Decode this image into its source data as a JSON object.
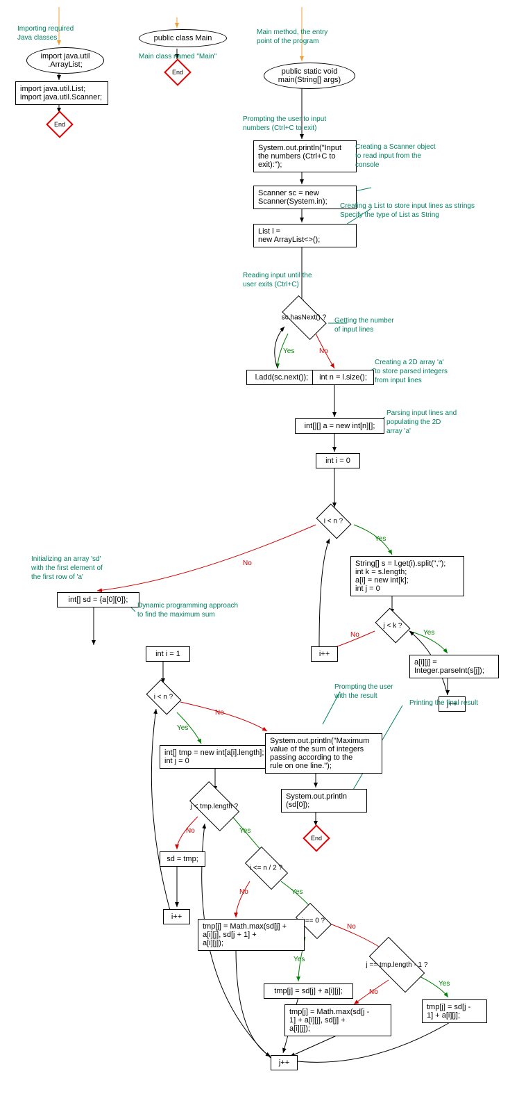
{
  "annotations": {
    "a1": "Importing required\nJava classes",
    "a2": "Main class named \"Main\"",
    "a3": "Main method, the entry\npoint of the program",
    "a4": "Prompting the user to input\nnumbers (Ctrl+C to exit)",
    "a5": "Creating a Scanner object\nto read input from the\nconsole",
    "a6": "Creating a List to store input lines as strings\nSpecify the type of List as String",
    "a7": "Reading input until the\nuser exits (Ctrl+C)",
    "a8": "Getting the number\nof input lines",
    "a9": "Creating a 2D array 'a'\nto store parsed integers\nfrom input lines",
    "a10": "Parsing input lines and\npopulating the 2D\narray 'a'",
    "a11": "Initializing an array 'sd'\nwith the first element of\nthe first row of 'a'",
    "a12": "Dynamic programming approach\nto find the maximum sum",
    "a13": "Prompting the user\nwith the result",
    "a14": "Printing the final result"
  },
  "nodes": {
    "n1": "import java.util\n.ArrayList;",
    "n2": "import java.util.List;\nimport java.util.Scanner;",
    "n3": "public class Main",
    "n4": "public static void\nmain(String[] args)",
    "n5": "System.out.println(\"Input\nthe numbers (Ctrl+C to\nexit):\");",
    "n6": "Scanner sc = new\nScanner(System.in);",
    "n7": "List<String> l =\nnew ArrayList<>();",
    "n8": "sc.hasNext() ?",
    "n9": "l.add(sc.next());",
    "n10": "int n = l.size();",
    "n11": "int[][] a = new int[n][];",
    "n12": "int i = 0",
    "n13": "i < n ?",
    "n14": "String[] s = l.get(i).split(\",\");\nint k = s.length;\na[i] = new int[k];\nint j = 0",
    "n15": "j < k ?",
    "n16": "a[i][j] =\nInteger.parseInt(s[j]);",
    "n17": "j++",
    "n18": "i++",
    "n19": "int[] sd = {a[0][0]};",
    "n20": "int i = 1",
    "n21": "i < n ?",
    "n22": "int[] tmp = new int[a[i].length];\nint j = 0",
    "n23": "j < tmp.length ?",
    "n24": "i <= n / 2 ?",
    "n25": "j == 0 ?",
    "n26": "j == tmp.length - 1 ?",
    "n27": "tmp[j] = sd[j] + a[i][j];",
    "n28": "tmp[j] = sd[j -\n1] + a[i][j];",
    "n29": "tmp[j] = Math.max(sd[j -\n1] + a[i][j], sd[j] +\na[i][j]);",
    "n30": "tmp[j] = Math.max(sd[j] +\na[i][j], sd[j + 1] +\na[i][j]);",
    "n31": "j++",
    "n32": "sd = tmp;",
    "n33": "i++",
    "n34": "System.out.println(\"Maximum\nvalue of the sum of integers\npassing according to the\nrule on one line.\");",
    "n35": "System.out.println\n(sd[0]);",
    "end": "End"
  },
  "labels": {
    "yes": "Yes",
    "no": "No"
  }
}
